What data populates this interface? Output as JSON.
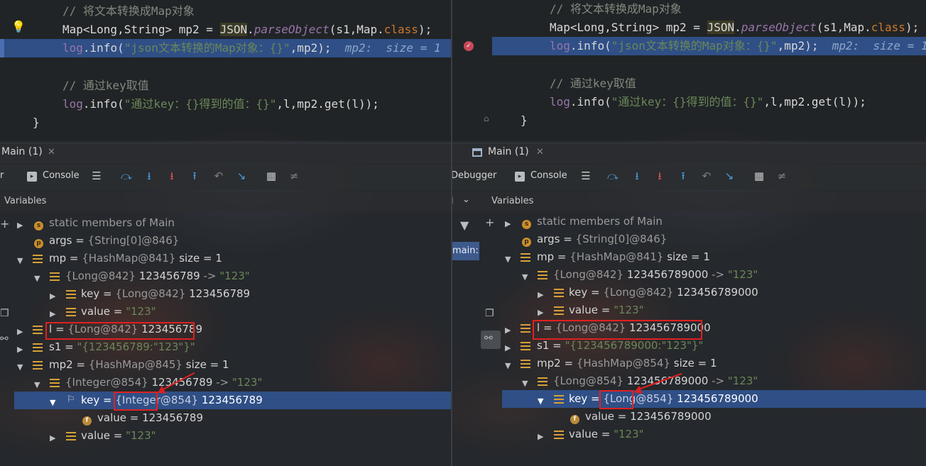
{
  "panes": [
    {
      "code": {
        "comment1": "// 将文本转换成Map对象",
        "line2": {
          "type": "Map<Long,String>",
          "var": " mp2 = ",
          "json": "JSON",
          "dot": ".",
          "method": "parseObject",
          "args": "(s1,Map.",
          "cls": "class",
          "end": ");"
        },
        "line3": {
          "log": "log",
          "info": ".info(",
          "str": "\"json文本转换的Map对象：{}\"",
          "rest": ",mp2);",
          "inline": "  mp2:  size = 1"
        },
        "comment2": "// 通过key取值",
        "line5": {
          "log": "log",
          "info": ".info(",
          "str": "\"通过key：{}得到的值：{}\"",
          "rest": ",l,mp2.get(l));"
        },
        "brace": "}"
      },
      "tab": "Main (1)",
      "debugger_label": "r",
      "console_label": "Console",
      "variables_label": "Variables",
      "vars": [
        {
          "name": "static members of Main"
        },
        {
          "name": "args",
          "value": "{String[0]@846}"
        },
        {
          "name": "mp",
          "value": "{HashMap@841}",
          "size": "size = 1"
        },
        {
          "name": "{Long@842}",
          "num": "123456789",
          "arrow": "->",
          "str": "\"123\""
        },
        {
          "name": "key",
          "value": "{Long@842}",
          "num": "123456789"
        },
        {
          "name": "value",
          "str": "\"123\""
        },
        {
          "name": "l",
          "value": "{Long@842}",
          "num": "123456789"
        },
        {
          "name": "s1",
          "str": "\"{123456789:\"123\"}\""
        },
        {
          "name": "mp2",
          "value": "{HashMap@845}",
          "size": "size = 1"
        },
        {
          "name": "{Integer@854}",
          "num": "123456789",
          "arrow": "->",
          "str": "\"123\""
        },
        {
          "name": "key",
          "value": "{Integer@854}",
          "num": "123456789"
        },
        {
          "name": "value",
          "num": "123456789"
        },
        {
          "name": "value",
          "str": "\"123\""
        }
      ]
    },
    {
      "code": {
        "comment1": "// 将文本转换成Map对象",
        "line2": {
          "type": "Map<Long,String>",
          "var": " mp2 = ",
          "json": "JSON",
          "dot": ".",
          "method": "parseObject",
          "args": "(s1,Map.",
          "cls": "class",
          "end": ");"
        },
        "line3": {
          "log": "log",
          "info": ".info(",
          "str": "\"json文本转换的Map对象：{}\"",
          "rest": ",mp2);",
          "inline": "  mp2:  size = 1"
        },
        "comment2": "// 通过key取值",
        "line5": {
          "log": "log",
          "info": ".info(",
          "str": "\"通过key：{}得到的值：{}\"",
          "rest": ",l,mp2.get(l));"
        },
        "brace": "}"
      },
      "tab": "Main (1)",
      "debugger_label": "Debugger",
      "console_label": "Console",
      "variables_label": "Variables",
      "thread_label": "main:",
      "vars": [
        {
          "name": "static members of Main"
        },
        {
          "name": "args",
          "value": "{String[0]@846}"
        },
        {
          "name": "mp",
          "value": "{HashMap@841}",
          "size": "size = 1"
        },
        {
          "name": "{Long@842}",
          "num": "123456789000",
          "arrow": "->",
          "str": "\"123\""
        },
        {
          "name": "key",
          "value": "{Long@842}",
          "num": "123456789000"
        },
        {
          "name": "value",
          "str": "\"123\""
        },
        {
          "name": "l",
          "value": "{Long@842}",
          "num": "123456789000"
        },
        {
          "name": "s1",
          "str": "\"{123456789000:\"123\"}\""
        },
        {
          "name": "mp2",
          "value": "{HashMap@854}",
          "size": "size = 1"
        },
        {
          "name": "{Long@854}",
          "num": "123456789000",
          "arrow": "->",
          "str": "\"123\""
        },
        {
          "name": "key",
          "value": "{Long@854}",
          "num": "123456789000"
        },
        {
          "name": "value",
          "num": "123456789000"
        },
        {
          "name": "value",
          "str": "\"123\""
        }
      ]
    }
  ],
  "colors": {
    "selection": "#2f4f86",
    "annotation": "#e02020"
  },
  "icons": [
    "bulb-icon",
    "breakpoint-icon",
    "console-icon",
    "step-over-icon",
    "step-into-icon",
    "force-step-into-icon",
    "step-out-icon",
    "drop-frame-icon",
    "run-to-cursor-icon",
    "evaluate-icon",
    "trace-icon",
    "filter-icon",
    "add-icon",
    "copy-icon",
    "glasses-icon"
  ]
}
